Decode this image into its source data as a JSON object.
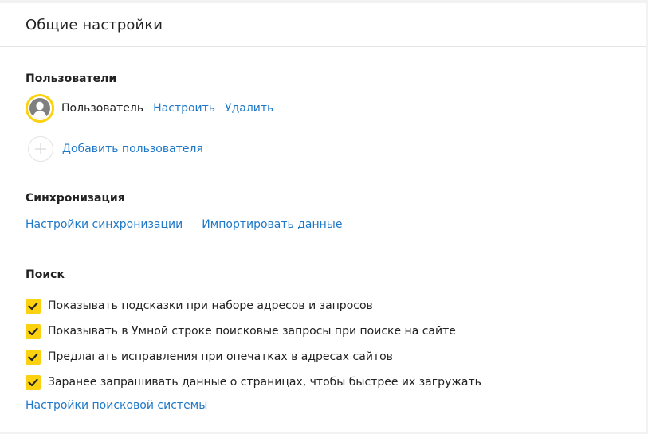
{
  "page": {
    "title": "Общие настройки"
  },
  "users": {
    "title": "Пользователи",
    "current_user": "Пользователь",
    "configure_link": "Настроить",
    "delete_link": "Удалить",
    "add_user_link": "Добавить пользователя"
  },
  "sync": {
    "title": "Синхронизация",
    "settings_link": "Настройки синхронизации",
    "import_link": "Импортировать данные"
  },
  "search": {
    "title": "Поиск",
    "options": [
      {
        "label": "Показывать подсказки при наборе адресов и запросов",
        "checked": true
      },
      {
        "label": "Показывать в Умной строке поисковые запросы при поиске на сайте",
        "checked": true
      },
      {
        "label": "Предлагать исправления при опечатках в адресах сайтов",
        "checked": true
      },
      {
        "label": "Заранее запрашивать данные о страницах, чтобы быстрее их загружать",
        "checked": true
      }
    ],
    "engine_link": "Настройки поисковой системы"
  },
  "colors": {
    "accent": "#fcd10f",
    "link": "#1e78c8",
    "text": "#222222"
  },
  "icons": {
    "avatar": "user-avatar-icon",
    "add": "plus-icon",
    "check": "checkmark-icon"
  }
}
